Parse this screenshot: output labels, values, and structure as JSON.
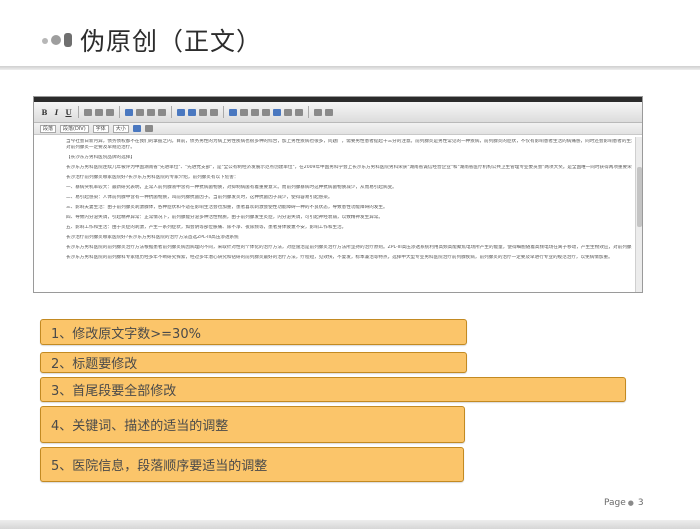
{
  "slide": {
    "title": "伪原创（正文）",
    "page_label": "Page",
    "page_number": "3"
  },
  "editor": {
    "toolbar": {
      "bold": "B",
      "italic": "I",
      "underline": "U",
      "style_label": "段落",
      "format_label": "段落(DIV)",
      "font_label": "字体",
      "size_label": "大小"
    },
    "lines": [
      "当今社会日新月异，债务债权都不在我们的掌握之内。目前，债务男性的为病上男性疾病也很多种的综合，加上男性疾病也很多，问题广，需要男性患者提起十三分的注意。前列腺炎是男性常见的一种疾病，前列腺炎的症状，不仅有影响患者生活的病痛感，同时还会影响患者的生活。所以，男性患者应该了解前列腺炎的一些症状，以便及早发现及早治疗，前列腺炎",
      "对前列腺炎一定要及早规范治疗。",
      "【长沙东方男科医院品牌的选择】",
      "长沙东方男科医院连续几年被评为中国湖南省\"先进单位\"、\"先进党支部\"，是\"全公有制经济发展示范点创建单位\"，在2009年中国男科学会上长沙东方男科医院男科荣获\"湖南省诚信经营企业\"和\"湖南省医疗机构公共卫生管理专业委员会\"两项大奖。是全国唯一同时获得两项重要荣誉的单位。而后在全国315诚信调查网上被评为\"长沙东方男科医院信用等级AAA的荣誉称号\"",
      "长沙治疗前列腺炎哪家医院好?长沙东方男科医院的专家介绍，前列腺炎有以下危害：",
      "一、暴病突机率较大：最新研究表明，正常人前列腺液中含有一种抗病菌物质，对抑制病菌有着重要意义。而前列腺暴病时这种抗病菌物质减少，从而易引起病变。",
      "二、易引起感染：人体前列腺中含有一种抗菌物质，叫前列腺抗菌因子。当前列腺发炎时，这种抗菌因子减少，使得容易引起感染。",
      "三、影响夫妻生活：由于前列腺炎刺激腺体，各种症状和不适在影响生活会也加重，患者喜欢刺激会使性功能障碍一种的不良状态，导致患性功能障碍的发生。",
      "四、导致内分泌失调，引起精神异常：正常情况下，前列腺能分泌多种活性物质，由于前列腺发生炎症，内分泌失调，可引起神经衰弱，以致精神发生异常。",
      "五、影响工作和生活：由于炎症的刺激，产生一系列症状，如会阴等部位胀痛、尿不净、夜尿频等，患者身体疲惫不安，影响工作和生活。",
      "长沙治疗前列腺炎哪家医院好?长沙东方男科医院的治疗方法首选ZPL-III高压渗透系统",
      "长沙东方男科医院的前列腺炎治疗方法根据患者前列腺炎病因病理的不同，采取针对性的个体化的治疗方法，对症施治是前列腺炎治疗方法所坚持的治疗原则。ZPL-III高压渗透系统利用高频高能聚焦电场所产生的能量，使得细胞随着高频电场在离子移动，产生生物效应，对前列腺炎有显著疗效，疏除杂菌，畅通腺管，排除毒素，促进腺体功能恢复，达到疏导止痛，组织再生修复的效果。",
      "长沙东方男科医院的前列腺科专家组历经多年不断研究探索，经过多年潜心研究和钻研的前列腺炎最好的治疗方法，疗程短，见效快，不复发，标本兼治等特点，选择中大型专业男科医院治疗前列腺疾病，前列腺炎的治疗一定要及早进行专业的规范治疗，以免病情加重。"
    ]
  },
  "requirements": [
    "1、修改原文字数>=30%",
    "2、标题要修改",
    "3、首尾段要全部修改",
    "4、关键词、描述的适当的调整",
    "5、医院信息，段落顺序要适当的调整"
  ],
  "colors": {
    "box_fill": "#fbc56a",
    "box_border": "#c38a22",
    "title_text": "#2c2c2c"
  }
}
